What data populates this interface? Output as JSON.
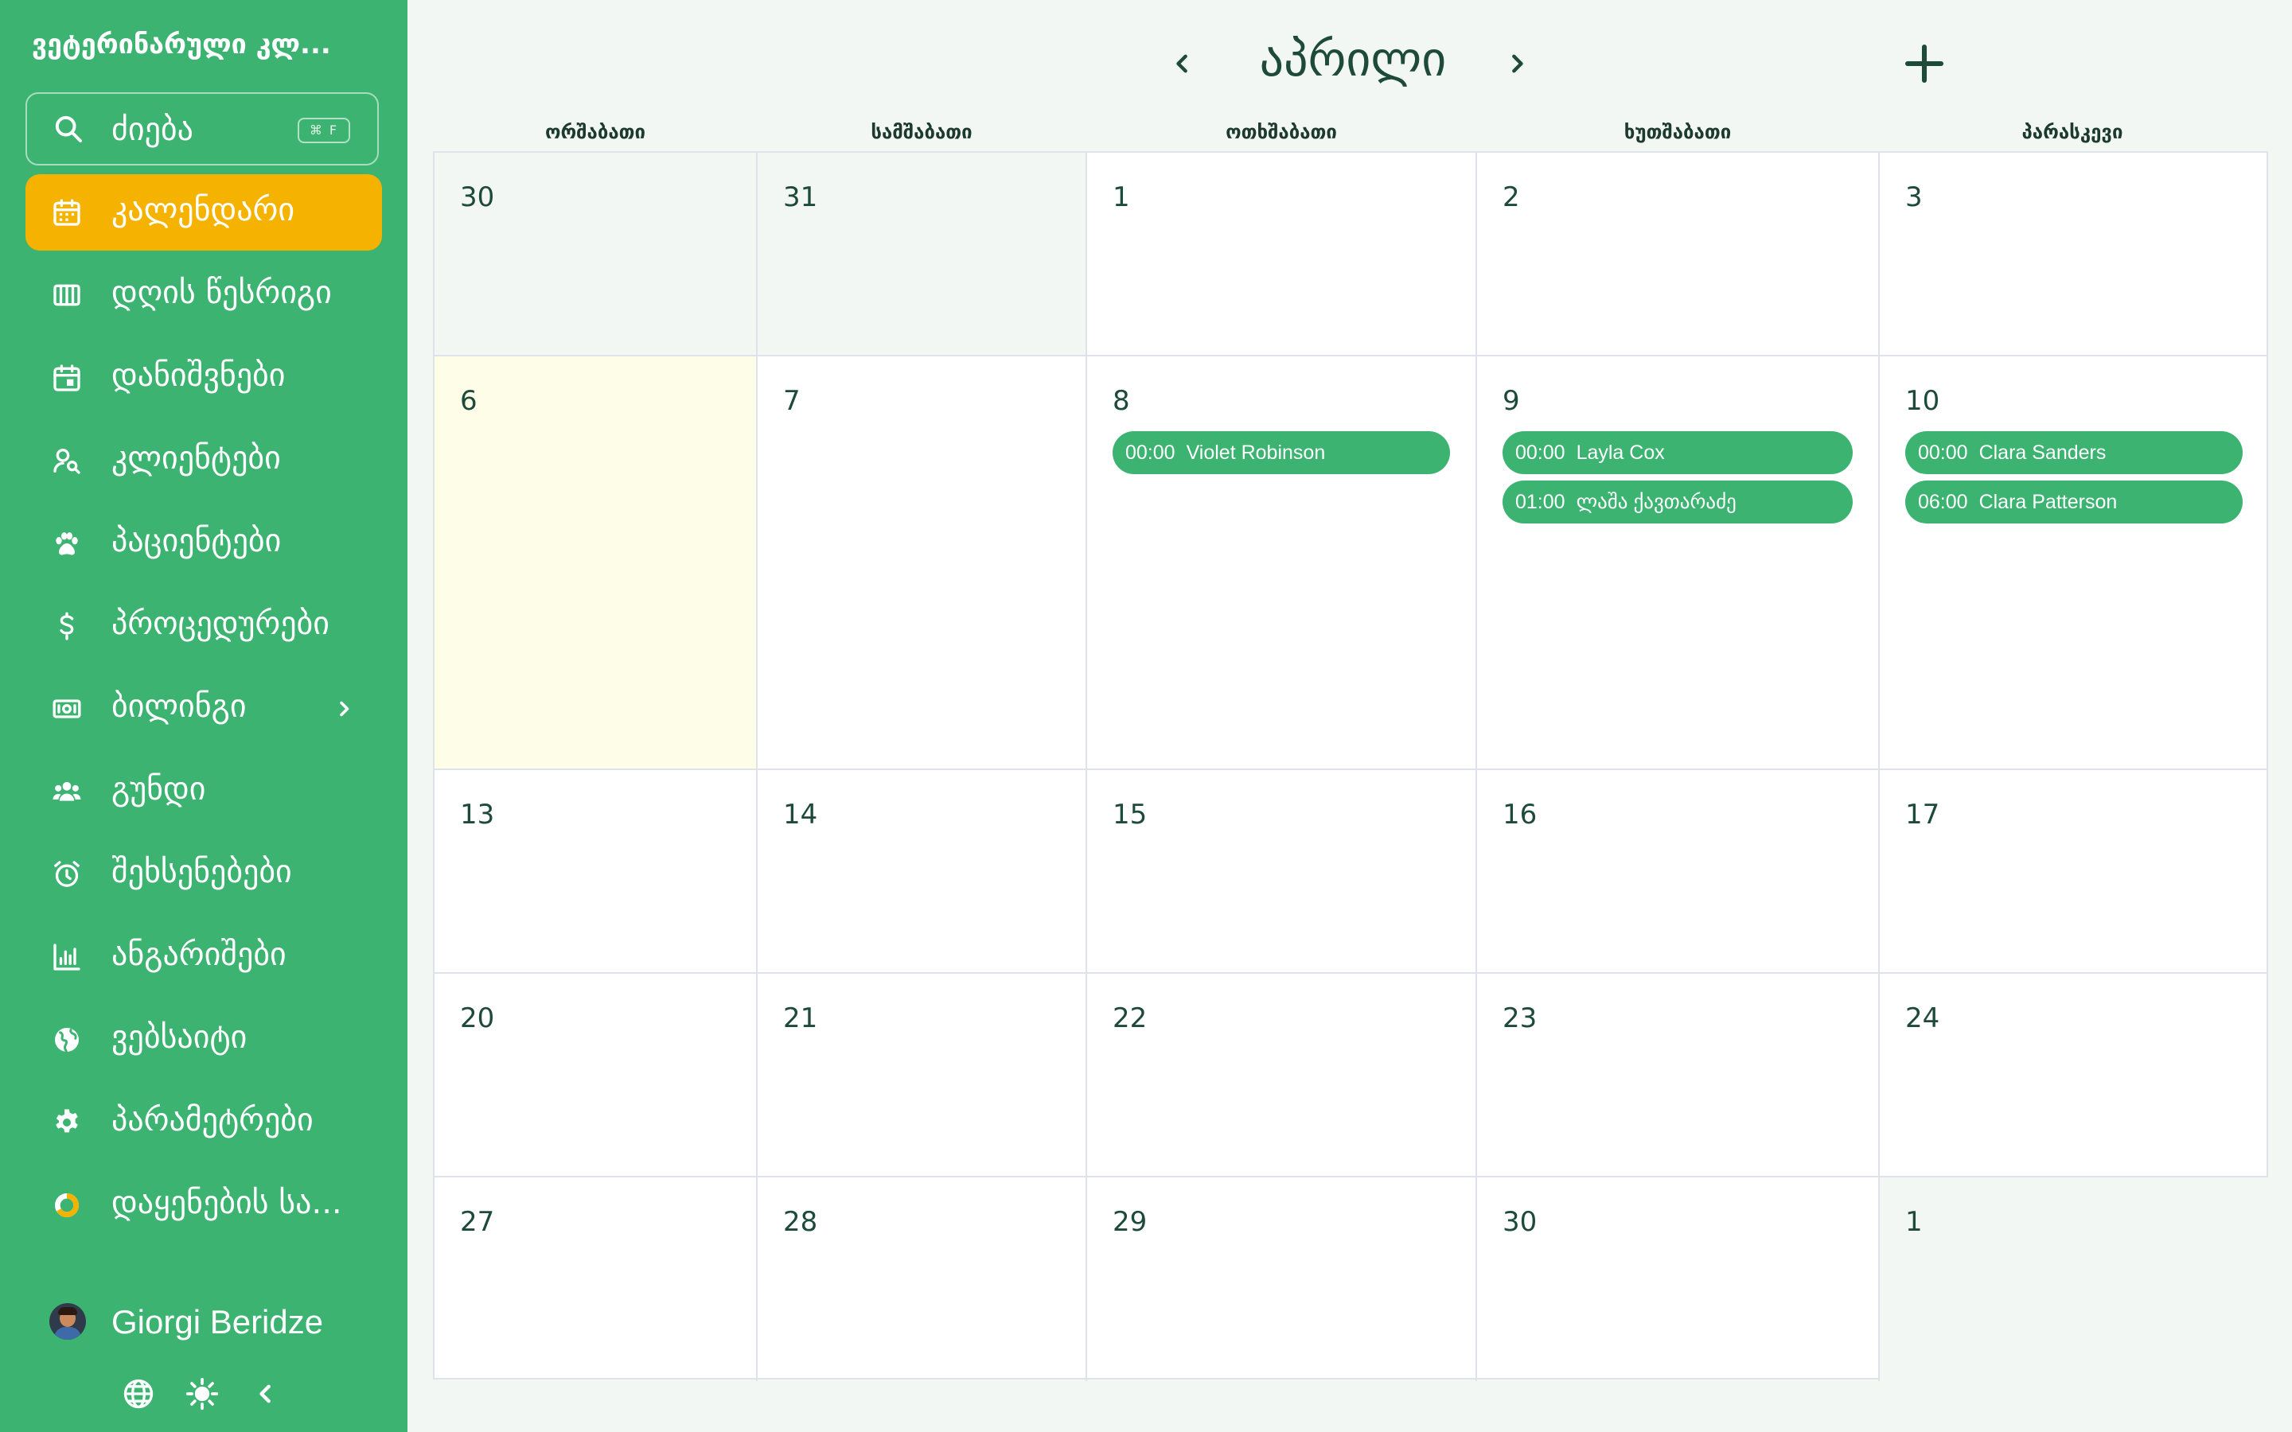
{
  "app": {
    "brand": "ვეტერინარული კლ..."
  },
  "search": {
    "label": "ძიება",
    "shortcut": "⌘ F"
  },
  "nav": [
    {
      "label": "კალენდარი",
      "icon": "calendar-icon",
      "active": true
    },
    {
      "label": "დღის წესრიგი",
      "icon": "columns-icon"
    },
    {
      "label": "დანიშვნები",
      "icon": "calendar-event-icon"
    },
    {
      "label": "კლიენტები",
      "icon": "user-search-icon"
    },
    {
      "label": "პაციენტები",
      "icon": "paw-icon"
    },
    {
      "label": "პროცედურები",
      "icon": "dollar-icon"
    },
    {
      "label": "ბილინგი",
      "icon": "cash-icon",
      "has_submenu": true
    },
    {
      "label": "გუნდი",
      "icon": "team-icon"
    },
    {
      "label": "შეხსენებები",
      "icon": "alarm-icon"
    },
    {
      "label": "ანგარიშები",
      "icon": "bar-chart-icon"
    },
    {
      "label": "ვებსაიტი",
      "icon": "globe-icon"
    },
    {
      "label": "პარამეტრები",
      "icon": "gear-icon"
    },
    {
      "label": "დაყენების სა...",
      "icon": "progress-ring-icon"
    }
  ],
  "user": {
    "name": "Giorgi Beridze"
  },
  "footer": {
    "icons": [
      "globe-icon",
      "sun-icon",
      "chevron-left-icon"
    ]
  },
  "calendar": {
    "month": "აპრილი",
    "weekdays": [
      "ორშაბათი",
      "სამშაბათი",
      "ოთხშაბათი",
      "ხუთშაბათი",
      "პარასკევი"
    ],
    "weeks": [
      [
        {
          "day": "30",
          "other": true
        },
        {
          "day": "31",
          "other": true
        },
        {
          "day": "1"
        },
        {
          "day": "2"
        },
        {
          "day": "3"
        }
      ],
      [
        {
          "day": "6",
          "today": true
        },
        {
          "day": "7"
        },
        {
          "day": "8",
          "events": [
            {
              "time": "00:00",
              "name": "Violet Robinson"
            }
          ]
        },
        {
          "day": "9",
          "events": [
            {
              "time": "00:00",
              "name": "Layla Cox"
            },
            {
              "time": "01:00",
              "name": "ლაშა ქავთარაძე"
            }
          ]
        },
        {
          "day": "10",
          "events": [
            {
              "time": "00:00",
              "name": "Clara Sanders"
            },
            {
              "time": "06:00",
              "name": "Clara Patterson"
            }
          ]
        }
      ],
      [
        {
          "day": "13"
        },
        {
          "day": "14"
        },
        {
          "day": "15"
        },
        {
          "day": "16"
        },
        {
          "day": "17"
        }
      ],
      [
        {
          "day": "20"
        },
        {
          "day": "21"
        },
        {
          "day": "22"
        },
        {
          "day": "23"
        },
        {
          "day": "24"
        }
      ],
      [
        {
          "day": "27"
        },
        {
          "day": "28"
        },
        {
          "day": "29"
        },
        {
          "day": "30"
        },
        {
          "day": "1",
          "other": true
        }
      ]
    ]
  },
  "colors": {
    "sidebar": "#3cb371",
    "active": "#f5b300",
    "event": "#3cb371",
    "today": "#fefee8"
  }
}
